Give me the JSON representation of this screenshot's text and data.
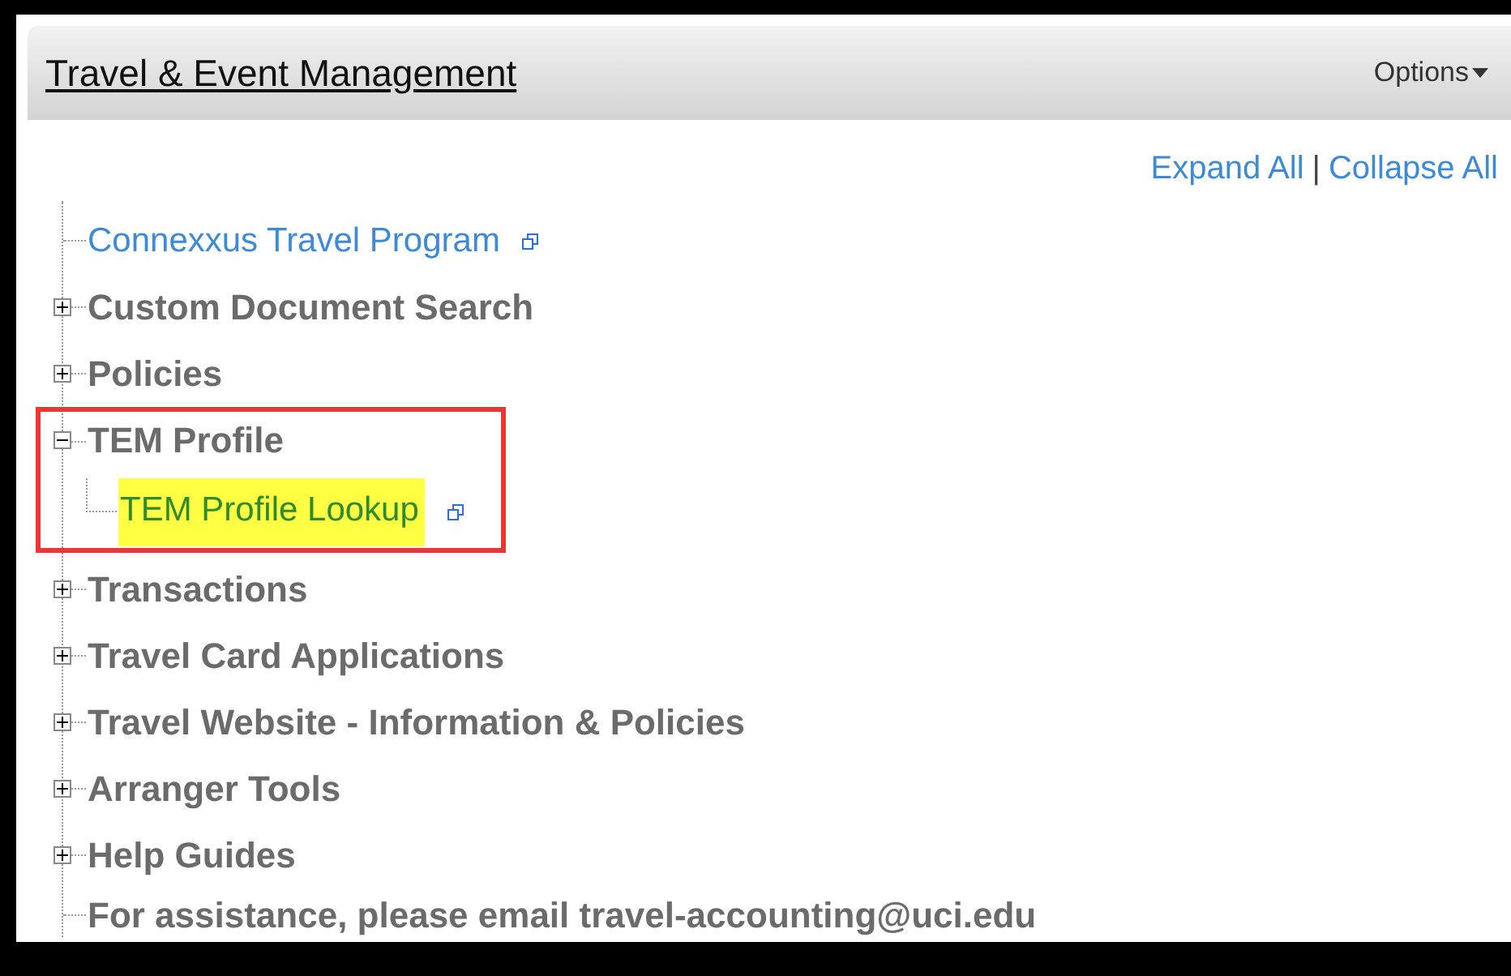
{
  "header": {
    "title": "Travel & Event Management",
    "options": "Options"
  },
  "links": [
    "Expand All",
    "Collapse All"
  ],
  "separator": "|",
  "tree": [
    {
      "kind": "link",
      "label": "Connexxus Travel Program",
      "external": true
    },
    {
      "kind": "folder",
      "label": "Custom Document Search",
      "expanded": false
    },
    {
      "kind": "folder",
      "label": "Policies",
      "expanded": false
    },
    {
      "kind": "folder",
      "label": "TEM Profile",
      "expanded": true,
      "annotated": true,
      "children": [
        {
          "kind": "link",
          "label": "TEM Profile Lookup",
          "external": true,
          "highlighted": true
        }
      ]
    },
    {
      "kind": "folder",
      "label": "Transactions",
      "expanded": false
    },
    {
      "kind": "folder",
      "label": "Travel Card Applications",
      "expanded": false
    },
    {
      "kind": "folder",
      "label": "Travel Website - Information & Policies",
      "expanded": false
    },
    {
      "kind": "folder",
      "label": "Arranger Tools",
      "expanded": false
    },
    {
      "kind": "folder",
      "label": "Help Guides",
      "expanded": false
    },
    {
      "kind": "text",
      "label": "For assistance, please email travel-accounting@uci.edu"
    }
  ]
}
